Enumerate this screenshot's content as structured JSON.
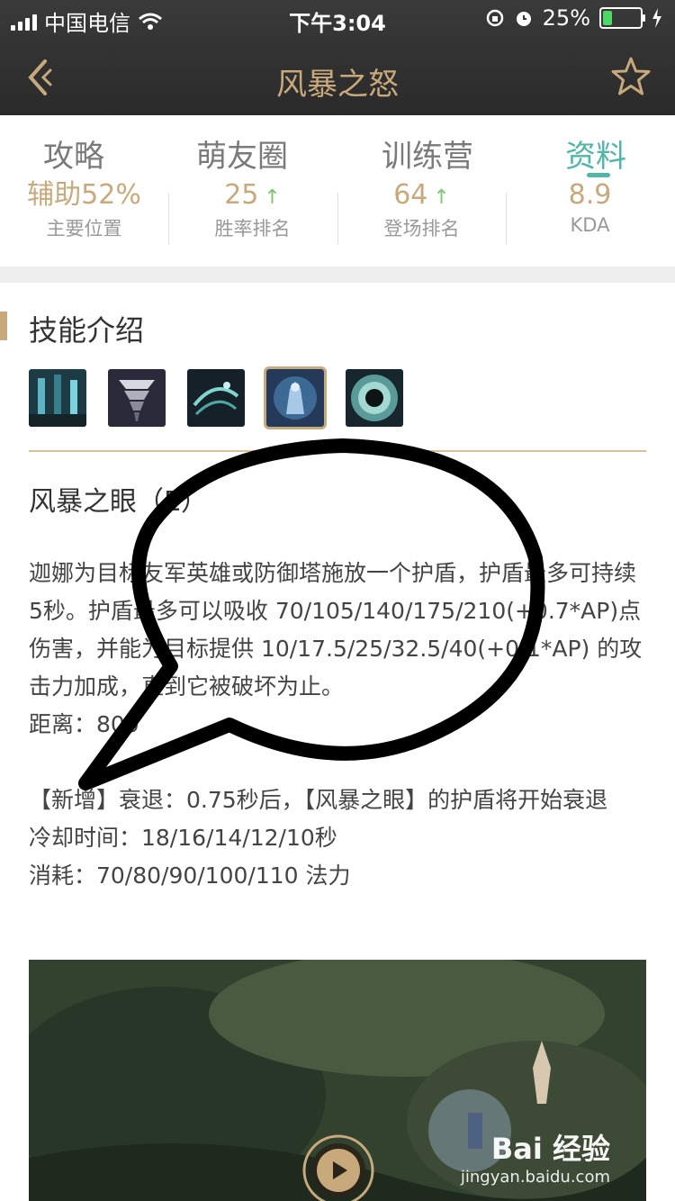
{
  "status_bar": {
    "carrier": "中国电信",
    "time": "下午3:04",
    "battery": "25%",
    "battery_level": 0.25
  },
  "nav": {
    "title": "风暴之怒"
  },
  "tabs": [
    {
      "label": "攻略"
    },
    {
      "label": "萌友圈"
    },
    {
      "label": "训练营"
    },
    {
      "label": "资料"
    }
  ],
  "stats": [
    {
      "value": "辅助52%",
      "label": "主要位置"
    },
    {
      "value": "25",
      "label": "胜率排名",
      "trend": "↑"
    },
    {
      "value": "64",
      "label": "登场排名",
      "trend": "↑"
    },
    {
      "value": "8.9",
      "label": "KDA"
    }
  ],
  "section": {
    "title": "技能介绍"
  },
  "skills": [
    {
      "icon": "passive-skill-icon"
    },
    {
      "icon": "tornado-skill-icon"
    },
    {
      "icon": "zephyr-skill-icon"
    },
    {
      "icon": "eye-of-storm-skill-icon",
      "selected": true
    },
    {
      "icon": "monsoon-skill-icon"
    }
  ],
  "detail": {
    "name": "风暴之眼（E）",
    "desc1": "迦娜为目标友军英雄或防御塔施放一个护盾，护盾最多可持续 5秒。护盾最多可以吸收 70/105/140/175/210(+0.7*AP)点伤害，并能为目标提供 10/17.5/25/32.5/40(+0.1*AP) 的攻击力加成，直到它被破坏为止。",
    "range": "距离：800",
    "new": "【新增】衰退：0.75秒后，【风暴之眼】的护盾将开始衰退",
    "cooldown": "冷却时间：18/16/14/12/10秒",
    "cost": "消耗：70/80/90/100/110 法力"
  },
  "watermark": {
    "main": "Bai 经验",
    "sub": "jingyan.baidu.com"
  }
}
